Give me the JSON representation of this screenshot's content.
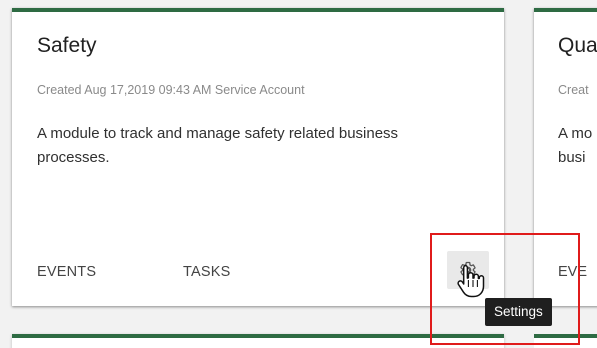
{
  "cards": {
    "main": {
      "title": "Safety",
      "meta": "Created Aug 17,2019 09:43 AM Service Account",
      "description": "A module to track and manage safety related business processes.",
      "actions": {
        "events_label": "EVENTS",
        "tasks_label": "TASKS"
      }
    },
    "next": {
      "title": "Qua",
      "meta": "Creat",
      "description_line1": "A mo",
      "description_line2": "busi",
      "action_label": "EVE"
    }
  },
  "tooltip": {
    "text": "Settings"
  },
  "colors": {
    "accent": "#2e6b43",
    "highlight": "#e01b1b",
    "tooltip_bg": "#1f1f1f"
  },
  "icons": {
    "settings": "gear-icon",
    "cursor": "hand-pointer-icon"
  }
}
